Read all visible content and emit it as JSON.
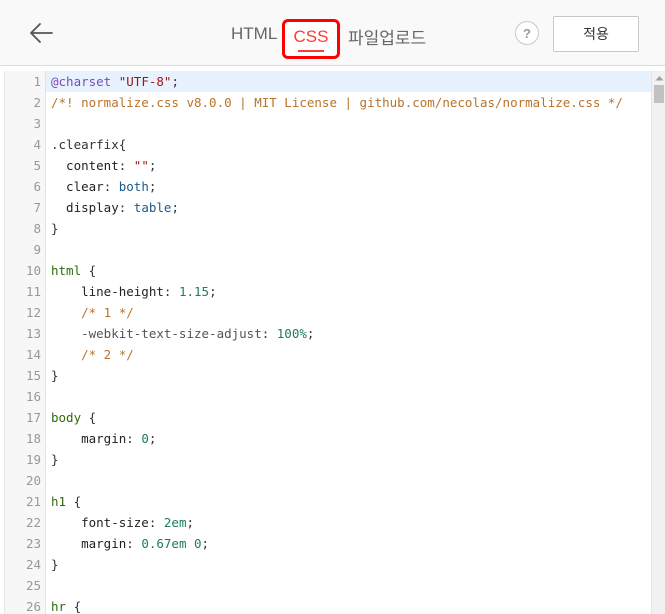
{
  "header": {
    "back_icon": "arrow-left-icon",
    "tabs": {
      "html": "HTML",
      "css": "CSS",
      "upload": "파일업로드"
    },
    "active_tab": "CSS",
    "help_label": "?",
    "apply_label": "적용",
    "accent_color": "#ff3b30",
    "highlight_box_color": "#ff0000"
  },
  "editor": {
    "language": "css",
    "lines": [
      {
        "n": "1",
        "tokens": [
          [
            "key",
            "@charset"
          ],
          [
            "plain",
            " "
          ],
          [
            "str",
            "\"UTF-8\""
          ],
          [
            "plain",
            ";"
          ]
        ]
      },
      {
        "n": "2",
        "tokens": [
          [
            "com",
            "/*! normalize.css v8.0.0 | MIT License | github.com/necolas/normalize.css */"
          ]
        ]
      },
      {
        "n": "3",
        "tokens": []
      },
      {
        "n": "4",
        "tokens": [
          [
            "plain",
            ".clearfix{"
          ]
        ]
      },
      {
        "n": "5",
        "tokens": [
          [
            "prop",
            "  content"
          ],
          [
            "plain",
            ": "
          ],
          [
            "str",
            "\"\""
          ],
          [
            "plain",
            ";"
          ]
        ]
      },
      {
        "n": "6",
        "tokens": [
          [
            "prop",
            "  clear"
          ],
          [
            "plain",
            ": "
          ],
          [
            "val",
            "both"
          ],
          [
            "plain",
            ";"
          ]
        ]
      },
      {
        "n": "7",
        "tokens": [
          [
            "prop",
            "  display"
          ],
          [
            "plain",
            ": "
          ],
          [
            "val",
            "table"
          ],
          [
            "plain",
            ";"
          ]
        ]
      },
      {
        "n": "8",
        "tokens": [
          [
            "plain",
            "}"
          ]
        ]
      },
      {
        "n": "9",
        "tokens": []
      },
      {
        "n": "10",
        "tokens": [
          [
            "sel",
            "html"
          ],
          [
            "plain",
            " {"
          ]
        ]
      },
      {
        "n": "11",
        "tokens": [
          [
            "prop",
            "    line-height"
          ],
          [
            "plain",
            ": "
          ],
          [
            "num",
            "1.15"
          ],
          [
            "plain",
            ";"
          ]
        ]
      },
      {
        "n": "12",
        "tokens": [
          [
            "com",
            "    /* 1 */"
          ]
        ]
      },
      {
        "n": "13",
        "tokens": [
          [
            "vendor",
            "    -webkit-text-size-adjust"
          ],
          [
            "plain",
            ": "
          ],
          [
            "num",
            "100%"
          ],
          [
            "plain",
            ";"
          ]
        ]
      },
      {
        "n": "14",
        "tokens": [
          [
            "com",
            "    /* 2 */"
          ]
        ]
      },
      {
        "n": "15",
        "tokens": [
          [
            "plain",
            "}"
          ]
        ]
      },
      {
        "n": "16",
        "tokens": []
      },
      {
        "n": "17",
        "tokens": [
          [
            "sel",
            "body"
          ],
          [
            "plain",
            " {"
          ]
        ]
      },
      {
        "n": "18",
        "tokens": [
          [
            "prop",
            "    margin"
          ],
          [
            "plain",
            ": "
          ],
          [
            "num",
            "0"
          ],
          [
            "plain",
            ";"
          ]
        ]
      },
      {
        "n": "19",
        "tokens": [
          [
            "plain",
            "}"
          ]
        ]
      },
      {
        "n": "20",
        "tokens": []
      },
      {
        "n": "21",
        "tokens": [
          [
            "sel",
            "h1"
          ],
          [
            "plain",
            " {"
          ]
        ]
      },
      {
        "n": "22",
        "tokens": [
          [
            "prop",
            "    font-size"
          ],
          [
            "plain",
            ": "
          ],
          [
            "num",
            "2em"
          ],
          [
            "plain",
            ";"
          ]
        ]
      },
      {
        "n": "23",
        "tokens": [
          [
            "prop",
            "    margin"
          ],
          [
            "plain",
            ": "
          ],
          [
            "num",
            "0.67em 0"
          ],
          [
            "plain",
            ";"
          ]
        ]
      },
      {
        "n": "24",
        "tokens": [
          [
            "plain",
            "}"
          ]
        ]
      },
      {
        "n": "25",
        "tokens": []
      },
      {
        "n": "26",
        "tokens": [
          [
            "sel",
            "hr"
          ],
          [
            "plain",
            " {"
          ]
        ]
      }
    ]
  }
}
